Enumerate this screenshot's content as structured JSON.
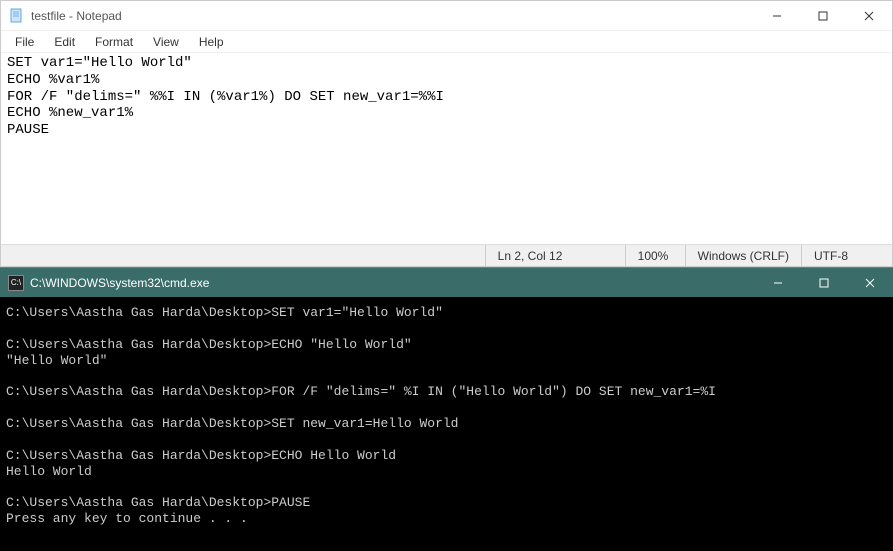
{
  "notepad": {
    "title": "testfile - Notepad",
    "menu": [
      "File",
      "Edit",
      "Format",
      "View",
      "Help"
    ],
    "content": "SET var1=\"Hello World\"\nECHO %var1%\nFOR /F \"delims=\" %%I IN (%var1%) DO SET new_var1=%%I\nECHO %new_var1%\nPAUSE",
    "status": {
      "position": "Ln 2, Col 12",
      "zoom": "100%",
      "eol": "Windows (CRLF)",
      "encoding": "UTF-8"
    }
  },
  "cmd": {
    "title": "C:\\WINDOWS\\system32\\cmd.exe",
    "icon_text": "C:\\",
    "output": "C:\\Users\\Aastha Gas Harda\\Desktop>SET var1=\"Hello World\"\n\nC:\\Users\\Aastha Gas Harda\\Desktop>ECHO \"Hello World\"\n\"Hello World\"\n\nC:\\Users\\Aastha Gas Harda\\Desktop>FOR /F \"delims=\" %I IN (\"Hello World\") DO SET new_var1=%I\n\nC:\\Users\\Aastha Gas Harda\\Desktop>SET new_var1=Hello World\n\nC:\\Users\\Aastha Gas Harda\\Desktop>ECHO Hello World\nHello World\n\nC:\\Users\\Aastha Gas Harda\\Desktop>PAUSE\nPress any key to continue . . ."
  }
}
